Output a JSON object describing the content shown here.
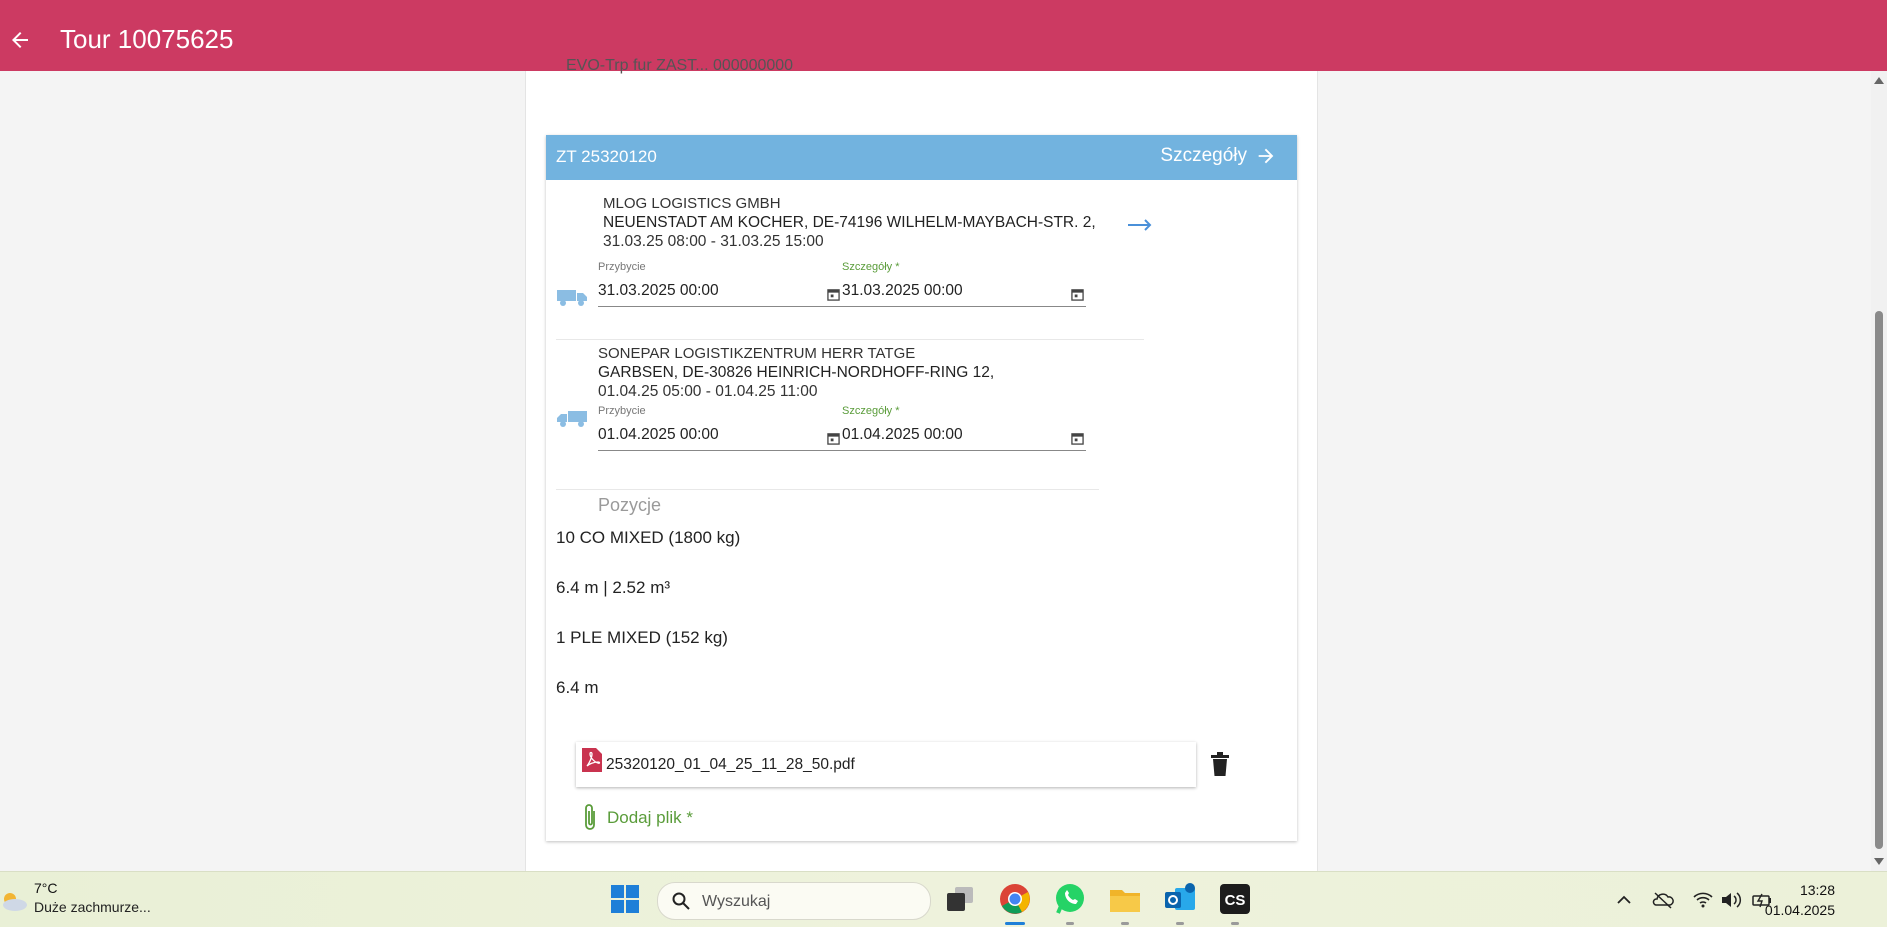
{
  "header": {
    "title": "Tour 10075625"
  },
  "cutoff_text": "EVO-Trp fur ZAST... 000000000",
  "order": {
    "ref": "ZT 25320120",
    "details_label": "Szczegóły",
    "stops": [
      {
        "company": "MLOG LOGISTICS GMBH",
        "address": "NEUENSTADT AM KOCHER, DE-74196 WILHELM-MAYBACH-STR. 2,",
        "window": "31.03.25 08:00 - 31.03.25 15:00",
        "arrival_label": "Przybycie",
        "arrival_value": "31.03.2025 00:00",
        "details_label": "Szczegóły *",
        "details_value": "31.03.2025 00:00"
      },
      {
        "company": "SONEPAR LOGISTIKZENTRUM HERR TATGE",
        "address": "GARBSEN, DE-30826 HEINRICH-NORDHOFF-RING 12,",
        "window": "01.04.25 05:00 - 01.04.25 11:00",
        "arrival_label": "Przybycie",
        "arrival_value": "01.04.2025 00:00",
        "details_label": "Szczegóły *",
        "details_value": "01.04.2025 00:00"
      }
    ],
    "positions_label": "Pozycje",
    "positions": [
      "10 CO MIXED (1800 kg)",
      "6.4 m | 2.52 m³",
      "1 PLE MIXED (152 kg)",
      "6.4 m"
    ],
    "file": {
      "name": "25320120_01_04_25_11_28_50.pdf"
    },
    "add_file_label": "Dodaj plik *"
  },
  "taskbar": {
    "weather_temp": "7°C",
    "weather_desc": "Duże zachmurze...",
    "search_placeholder": "Wyszukaj",
    "time": "13:28",
    "date": "01.04.2025"
  },
  "colors": {
    "appbar": "#cc3a62",
    "card_header": "#72b3df",
    "accent_green": "#5a9c3a"
  }
}
